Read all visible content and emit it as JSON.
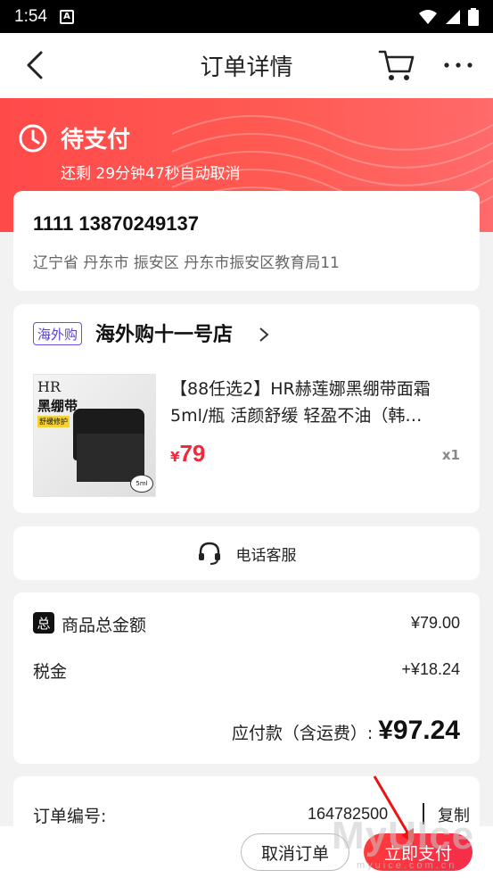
{
  "status_bar": {
    "time": "1:54",
    "sim_label": "A"
  },
  "nav": {
    "title": "订单详情"
  },
  "banner": {
    "status": "待支付",
    "countdown": "还剩 29分钟47秒自动取消"
  },
  "address": {
    "name_phone": "1111 13870249137",
    "line": "辽宁省 丹东市 振安区 丹东市振安区教育局11"
  },
  "shop": {
    "badge": "海外购",
    "name": "海外购十一号店",
    "product": {
      "title": "【88任选2】HR赫莲娜黑绷带面霜5ml/瓶 活颜舒缓 轻盈不油（韩…",
      "currency": "¥",
      "price": "79",
      "qty": "x1",
      "thumb_brand": "HR",
      "thumb_cn": "黑绷带",
      "thumb_tag": "舒缓修护",
      "thumb_ml": "5ml"
    }
  },
  "service": {
    "label": "电话客服"
  },
  "summary": {
    "badge": "总",
    "goods_label": "商品总金额",
    "goods_value": "¥79.00",
    "tax_label": "税金",
    "tax_value": "+¥18.24",
    "total_label": "应付款（含运费）:",
    "total_value": "¥97.24"
  },
  "order": {
    "number_label": "订单编号:",
    "number_value": "164782500",
    "copy": "复制"
  },
  "bottom": {
    "cancel": "取消订单",
    "pay": "立即支付"
  },
  "watermark": {
    "main": "MyUIce",
    "sub": "myuice.com.cn"
  },
  "colors": {
    "accent": "#f2283c",
    "banner": "#ff4a4a",
    "badge": "#6b4ee6"
  }
}
